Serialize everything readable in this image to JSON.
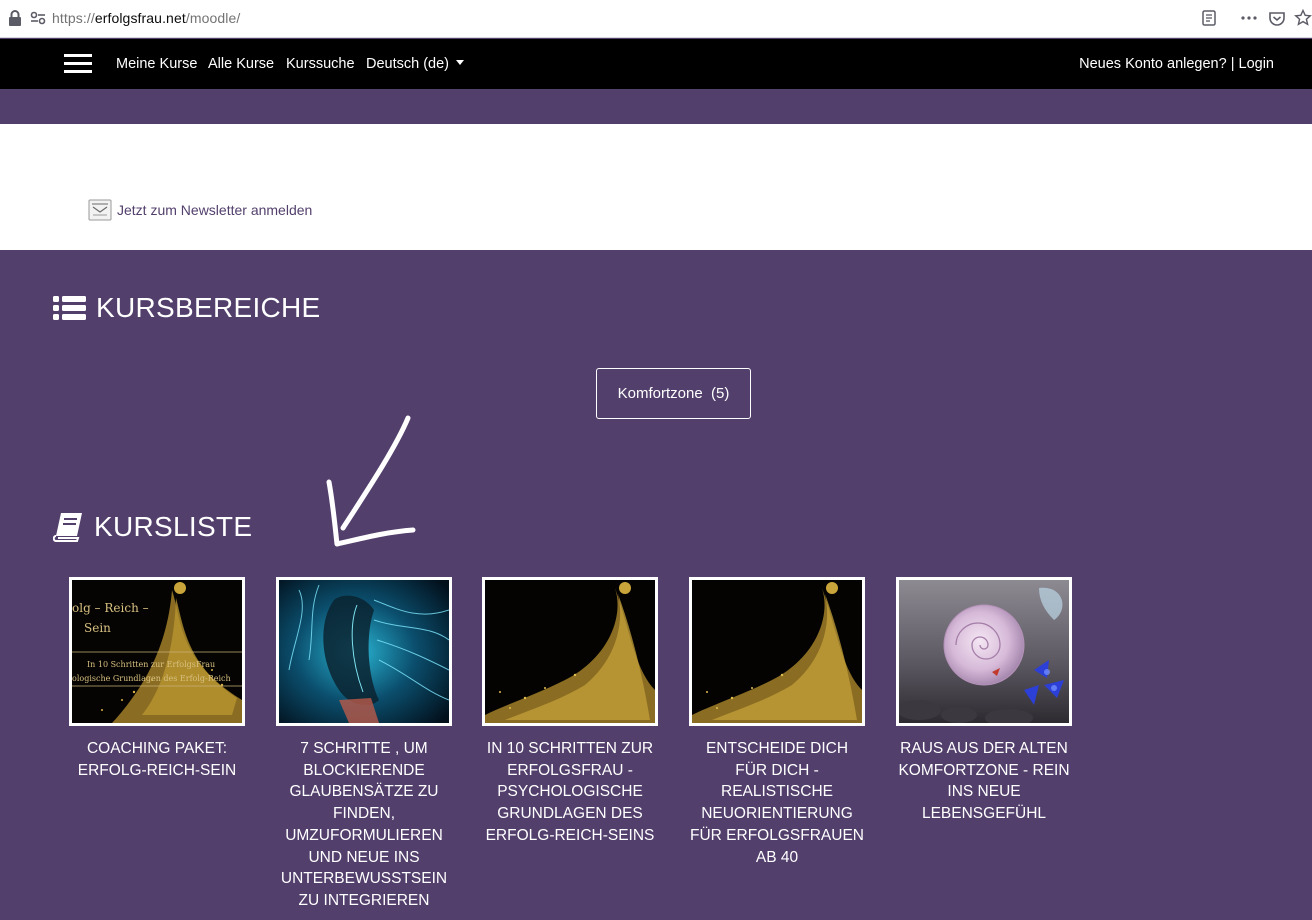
{
  "browser": {
    "url_scheme": "https://",
    "url_host": "erfolgsfrau.net",
    "url_path": "/moodle/"
  },
  "navbar": {
    "links": [
      "Meine Kurse",
      "Alle Kurse",
      "Kurssuche"
    ],
    "language": "Deutsch (de)",
    "register_label": "Neues Konto anlegen?",
    "separator": " | ",
    "login_label": "Login"
  },
  "newsletter": {
    "label": "Jetzt zum Newsletter anmelden"
  },
  "categories_section": {
    "title": "KURSBEREICHE",
    "category_button": "Komfortzone  (5)"
  },
  "courses_section": {
    "title": "KURSLISTE",
    "courses": [
      {
        "title": "COACHING PAKET: ERFOLG-REICH-SEIN",
        "thumb_text_1": "olg – Reich –",
        "thumb_text_2": "Sein",
        "thumb_text_3": "In 10 Schritten zur ErfolgsFrau",
        "thumb_text_4": "ologische Grundlagen des Erfolg-Reich"
      },
      {
        "title": "7 SCHRITTE , UM BLOCKIERENDE GLAUBENSÄTZE ZU FINDEN, UMZUFORMULIEREN UND NEUE INS UNTERBEWUSSTSEIN ZU INTEGRIEREN"
      },
      {
        "title": "IN 10 SCHRITTEN ZUR ERFOLGSFRAU - PSYCHOLOGISCHE GRUNDLAGEN DES ERFOLG-REICH-SEINS"
      },
      {
        "title": "ENTSCHEIDE DICH FÜR DICH - REALISTISCHE NEUORIENTIERUNG FÜR ERFOLGSFRAUEN AB 40"
      },
      {
        "title": "RAUS AUS DER ALTEN KOMFORTZONE - REIN INS NEUE LEBENSGEFÜHL"
      }
    ]
  },
  "colors": {
    "brand_purple": "#523f6c",
    "navbar": "#000000",
    "text_light": "#ffffff"
  }
}
